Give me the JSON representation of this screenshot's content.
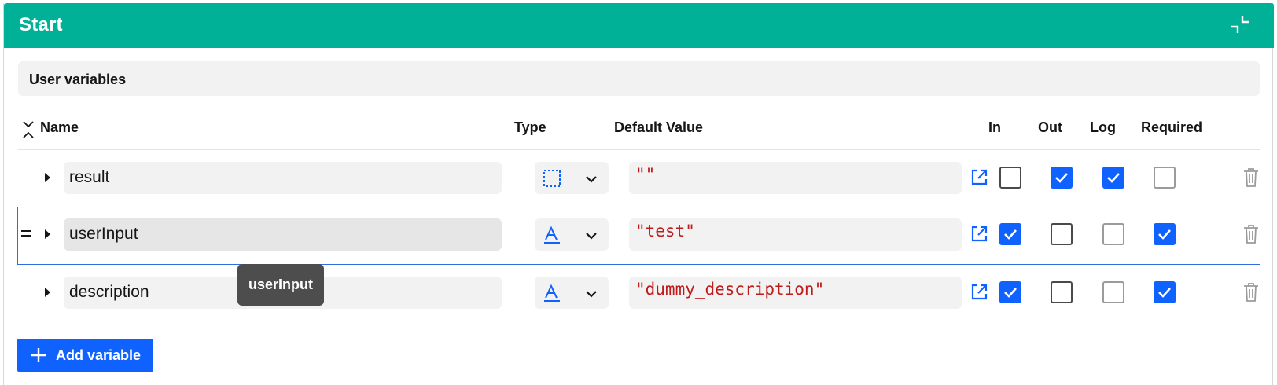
{
  "header": {
    "title": "Start",
    "collapse_icon": "collapse-icon",
    "color": "#00b097"
  },
  "section": {
    "title": "User variables"
  },
  "columns": {
    "name": "Name",
    "type": "Type",
    "default_value": "Default Value",
    "in": "In",
    "out": "Out",
    "log": "Log",
    "required": "Required"
  },
  "rows": [
    {
      "name": "result",
      "type_icon": "any-type-icon",
      "default_value": "\"\"",
      "in": false,
      "out": true,
      "log": true,
      "required": false,
      "required_disabled": true,
      "log_disabled": false
    },
    {
      "name": "userInput",
      "type_icon": "string-type-icon",
      "default_value": "\"test\"",
      "in": true,
      "out": false,
      "log": false,
      "required": true,
      "required_disabled": false,
      "log_disabled": true
    },
    {
      "name": "description",
      "type_icon": "string-type-icon",
      "default_value": "\"dummy_description\"",
      "in": true,
      "out": false,
      "log": false,
      "required": true,
      "required_disabled": false,
      "log_disabled": true
    }
  ],
  "tooltip": {
    "text": "userInput"
  },
  "add_button": {
    "label": "Add variable"
  },
  "colors": {
    "accent": "#0f62fe",
    "value_text": "#c01b1b"
  }
}
